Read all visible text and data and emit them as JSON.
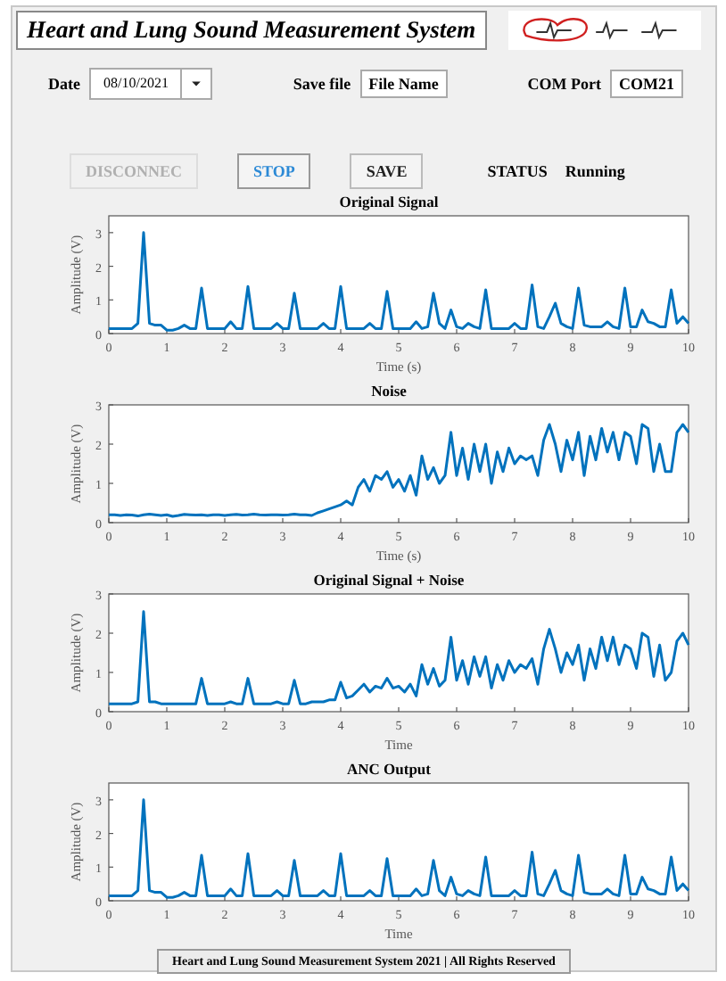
{
  "header": {
    "title": "Heart and Lung Sound Measurement System"
  },
  "fields": [
    {
      "label": "Date",
      "value": "08/10/2021",
      "kind": "dropdown"
    },
    {
      "label": "Save file",
      "value": "File Name",
      "kind": "text"
    },
    {
      "label": "COM Port",
      "value": "COM21",
      "kind": "text"
    }
  ],
  "buttons": [
    {
      "label": "DISCONNEC",
      "disabled": true,
      "active": false
    },
    {
      "label": "STOP",
      "disabled": false,
      "active": true
    },
    {
      "label": "SAVE",
      "disabled": false,
      "active": false
    }
  ],
  "status": {
    "label": "STATUS",
    "value": "Running"
  },
  "plots": [
    {
      "chart_data": {
        "type": "line",
        "title": "Original Signal",
        "xlabel": "Time (s)",
        "ylabel": "Amplitude (V)",
        "xlim": [
          0,
          10
        ],
        "ylim": [
          0,
          3.5
        ],
        "xticks": [
          0,
          1,
          2,
          3,
          4,
          5,
          6,
          7,
          8,
          9,
          10
        ],
        "yticks": [
          0,
          1,
          2,
          3
        ],
        "x": [
          0,
          0.1,
          0.2,
          0.3,
          0.4,
          0.5,
          0.6,
          0.7,
          0.8,
          0.9,
          1,
          1.1,
          1.2,
          1.3,
          1.4,
          1.5,
          1.6,
          1.7,
          1.8,
          1.9,
          2,
          2.1,
          2.2,
          2.3,
          2.4,
          2.5,
          2.6,
          2.7,
          2.8,
          2.9,
          3,
          3.1,
          3.2,
          3.3,
          3.4,
          3.5,
          3.6,
          3.7,
          3.8,
          3.9,
          4,
          4.1,
          4.2,
          4.3,
          4.4,
          4.5,
          4.6,
          4.7,
          4.8,
          4.9,
          5,
          5.1,
          5.2,
          5.3,
          5.4,
          5.5,
          5.6,
          5.7,
          5.8,
          5.9,
          6,
          6.1,
          6.2,
          6.3,
          6.4,
          6.5,
          6.6,
          6.7,
          6.8,
          6.9,
          7,
          7.1,
          7.2,
          7.3,
          7.4,
          7.5,
          7.6,
          7.7,
          7.8,
          7.9,
          8,
          8.1,
          8.2,
          8.3,
          8.4,
          8.5,
          8.6,
          8.7,
          8.8,
          8.9,
          9,
          9.1,
          9.2,
          9.3,
          9.4,
          9.5,
          9.6,
          9.7,
          9.8,
          9.9,
          10
        ],
        "series": [
          {
            "color": "#0072bd",
            "values": [
              0.15,
              0.15,
              0.15,
              0.15,
              0.15,
              0.3,
              3.0,
              0.3,
              0.25,
              0.25,
              0.1,
              0.1,
              0.15,
              0.25,
              0.15,
              0.15,
              1.35,
              0.15,
              0.15,
              0.15,
              0.15,
              0.35,
              0.15,
              0.15,
              1.4,
              0.15,
              0.15,
              0.15,
              0.15,
              0.3,
              0.15,
              0.15,
              1.2,
              0.15,
              0.15,
              0.15,
              0.15,
              0.3,
              0.15,
              0.15,
              1.4,
              0.15,
              0.15,
              0.15,
              0.15,
              0.3,
              0.15,
              0.15,
              1.25,
              0.15,
              0.15,
              0.15,
              0.15,
              0.35,
              0.15,
              0.2,
              1.2,
              0.3,
              0.15,
              0.7,
              0.2,
              0.15,
              0.3,
              0.2,
              0.15,
              1.3,
              0.15,
              0.15,
              0.15,
              0.15,
              0.3,
              0.15,
              0.15,
              1.45,
              0.2,
              0.15,
              0.5,
              0.9,
              0.3,
              0.2,
              0.15,
              1.35,
              0.25,
              0.2,
              0.2,
              0.2,
              0.35,
              0.2,
              0.15,
              1.35,
              0.2,
              0.2,
              0.7,
              0.35,
              0.3,
              0.2,
              0.2,
              1.3,
              0.3,
              0.5,
              0.3
            ]
          }
        ]
      }
    },
    {
      "chart_data": {
        "type": "line",
        "title": "Noise",
        "xlabel": "Time (s)",
        "ylabel": "Amplitude (V)",
        "xlim": [
          0,
          10
        ],
        "ylim": [
          0,
          3
        ],
        "xticks": [
          0,
          1,
          2,
          3,
          4,
          5,
          6,
          7,
          8,
          9,
          10
        ],
        "yticks": [
          0,
          1,
          2,
          3
        ],
        "x": [
          0,
          0.1,
          0.2,
          0.3,
          0.4,
          0.5,
          0.6,
          0.7,
          0.8,
          0.9,
          1,
          1.1,
          1.2,
          1.3,
          1.4,
          1.5,
          1.6,
          1.7,
          1.8,
          1.9,
          2,
          2.1,
          2.2,
          2.3,
          2.4,
          2.5,
          2.6,
          2.7,
          2.8,
          2.9,
          3,
          3.1,
          3.2,
          3.3,
          3.4,
          3.5,
          3.6,
          3.7,
          3.8,
          3.9,
          4,
          4.1,
          4.2,
          4.3,
          4.4,
          4.5,
          4.6,
          4.7,
          4.8,
          4.9,
          5,
          5.1,
          5.2,
          5.3,
          5.4,
          5.5,
          5.6,
          5.7,
          5.8,
          5.9,
          6,
          6.1,
          6.2,
          6.3,
          6.4,
          6.5,
          6.6,
          6.7,
          6.8,
          6.9,
          7,
          7.1,
          7.2,
          7.3,
          7.4,
          7.5,
          7.6,
          7.7,
          7.8,
          7.9,
          8,
          8.1,
          8.2,
          8.3,
          8.4,
          8.5,
          8.6,
          8.7,
          8.8,
          8.9,
          9,
          9.1,
          9.2,
          9.3,
          9.4,
          9.5,
          9.6,
          9.7,
          9.8,
          9.9,
          10
        ],
        "series": [
          {
            "color": "#0072bd",
            "values": [
              0.2,
              0.2,
              0.18,
              0.2,
              0.19,
              0.17,
              0.2,
              0.22,
              0.2,
              0.18,
              0.2,
              0.16,
              0.18,
              0.21,
              0.2,
              0.19,
              0.2,
              0.18,
              0.2,
              0.2,
              0.18,
              0.2,
              0.21,
              0.19,
              0.2,
              0.22,
              0.2,
              0.19,
              0.2,
              0.2,
              0.19,
              0.2,
              0.22,
              0.2,
              0.2,
              0.18,
              0.25,
              0.3,
              0.35,
              0.4,
              0.45,
              0.55,
              0.45,
              0.9,
              1.1,
              0.8,
              1.2,
              1.1,
              1.3,
              0.9,
              1.1,
              0.8,
              1.2,
              0.7,
              1.7,
              1.1,
              1.4,
              1.0,
              1.2,
              2.3,
              1.2,
              1.9,
              1.1,
              2.0,
              1.3,
              2.0,
              1.0,
              1.8,
              1.3,
              1.9,
              1.5,
              1.7,
              1.6,
              1.7,
              1.2,
              2.1,
              2.5,
              2.0,
              1.3,
              2.1,
              1.6,
              2.3,
              1.2,
              2.2,
              1.6,
              2.4,
              1.8,
              2.3,
              1.6,
              2.3,
              2.2,
              1.5,
              2.5,
              2.4,
              1.3,
              2.0,
              1.3,
              1.3,
              2.3,
              2.5,
              2.3
            ]
          }
        ]
      }
    },
    {
      "chart_data": {
        "type": "line",
        "title": "Original Signal + Noise",
        "xlabel": "Time",
        "ylabel": "Amplitude (V)",
        "xlim": [
          0,
          10
        ],
        "ylim": [
          0,
          3
        ],
        "xticks": [
          0,
          1,
          2,
          3,
          4,
          5,
          6,
          7,
          8,
          9,
          10
        ],
        "yticks": [
          0,
          1,
          2,
          3
        ],
        "x": [
          0,
          0.1,
          0.2,
          0.3,
          0.4,
          0.5,
          0.6,
          0.7,
          0.8,
          0.9,
          1,
          1.1,
          1.2,
          1.3,
          1.4,
          1.5,
          1.6,
          1.7,
          1.8,
          1.9,
          2,
          2.1,
          2.2,
          2.3,
          2.4,
          2.5,
          2.6,
          2.7,
          2.8,
          2.9,
          3,
          3.1,
          3.2,
          3.3,
          3.4,
          3.5,
          3.6,
          3.7,
          3.8,
          3.9,
          4,
          4.1,
          4.2,
          4.3,
          4.4,
          4.5,
          4.6,
          4.7,
          4.8,
          4.9,
          5,
          5.1,
          5.2,
          5.3,
          5.4,
          5.5,
          5.6,
          5.7,
          5.8,
          5.9,
          6,
          6.1,
          6.2,
          6.3,
          6.4,
          6.5,
          6.6,
          6.7,
          6.8,
          6.9,
          7,
          7.1,
          7.2,
          7.3,
          7.4,
          7.5,
          7.6,
          7.7,
          7.8,
          7.9,
          8,
          8.1,
          8.2,
          8.3,
          8.4,
          8.5,
          8.6,
          8.7,
          8.8,
          8.9,
          9,
          9.1,
          9.2,
          9.3,
          9.4,
          9.5,
          9.6,
          9.7,
          9.8,
          9.9,
          10
        ],
        "series": [
          {
            "color": "#0072bd",
            "values": [
              0.2,
              0.2,
              0.2,
              0.2,
              0.2,
              0.25,
              2.55,
              0.25,
              0.25,
              0.2,
              0.2,
              0.2,
              0.2,
              0.2,
              0.2,
              0.2,
              0.85,
              0.2,
              0.2,
              0.2,
              0.2,
              0.25,
              0.2,
              0.2,
              0.85,
              0.2,
              0.2,
              0.2,
              0.2,
              0.25,
              0.2,
              0.2,
              0.8,
              0.2,
              0.2,
              0.25,
              0.25,
              0.25,
              0.3,
              0.3,
              0.75,
              0.35,
              0.4,
              0.55,
              0.7,
              0.5,
              0.65,
              0.6,
              0.85,
              0.6,
              0.65,
              0.5,
              0.7,
              0.4,
              1.2,
              0.7,
              1.1,
              0.65,
              0.8,
              1.9,
              0.8,
              1.3,
              0.7,
              1.4,
              0.9,
              1.4,
              0.6,
              1.2,
              0.8,
              1.3,
              1.0,
              1.2,
              1.1,
              1.35,
              0.7,
              1.6,
              2.1,
              1.6,
              1.0,
              1.5,
              1.2,
              1.7,
              0.8,
              1.6,
              1.1,
              1.9,
              1.3,
              1.9,
              1.2,
              1.7,
              1.6,
              1.1,
              2.0,
              1.9,
              0.9,
              1.7,
              0.8,
              1.0,
              1.8,
              2.0,
              1.7
            ]
          }
        ]
      }
    },
    {
      "chart_data": {
        "type": "line",
        "title": "ANC Output",
        "xlabel": "Time",
        "ylabel": "Amplitude (V)",
        "xlim": [
          0,
          10
        ],
        "ylim": [
          0,
          3.5
        ],
        "xticks": [
          0,
          1,
          2,
          3,
          4,
          5,
          6,
          7,
          8,
          9,
          10
        ],
        "yticks": [
          0,
          1,
          2,
          3
        ],
        "x": [
          0,
          0.1,
          0.2,
          0.3,
          0.4,
          0.5,
          0.6,
          0.7,
          0.8,
          0.9,
          1,
          1.1,
          1.2,
          1.3,
          1.4,
          1.5,
          1.6,
          1.7,
          1.8,
          1.9,
          2,
          2.1,
          2.2,
          2.3,
          2.4,
          2.5,
          2.6,
          2.7,
          2.8,
          2.9,
          3,
          3.1,
          3.2,
          3.3,
          3.4,
          3.5,
          3.6,
          3.7,
          3.8,
          3.9,
          4,
          4.1,
          4.2,
          4.3,
          4.4,
          4.5,
          4.6,
          4.7,
          4.8,
          4.9,
          5,
          5.1,
          5.2,
          5.3,
          5.4,
          5.5,
          5.6,
          5.7,
          5.8,
          5.9,
          6,
          6.1,
          6.2,
          6.3,
          6.4,
          6.5,
          6.6,
          6.7,
          6.8,
          6.9,
          7,
          7.1,
          7.2,
          7.3,
          7.4,
          7.5,
          7.6,
          7.7,
          7.8,
          7.9,
          8,
          8.1,
          8.2,
          8.3,
          8.4,
          8.5,
          8.6,
          8.7,
          8.8,
          8.9,
          9,
          9.1,
          9.2,
          9.3,
          9.4,
          9.5,
          9.6,
          9.7,
          9.8,
          9.9,
          10
        ],
        "series": [
          {
            "color": "#0072bd",
            "values": [
              0.15,
              0.15,
              0.15,
              0.15,
              0.15,
              0.3,
              3.0,
              0.3,
              0.25,
              0.25,
              0.1,
              0.1,
              0.15,
              0.25,
              0.15,
              0.15,
              1.35,
              0.15,
              0.15,
              0.15,
              0.15,
              0.35,
              0.15,
              0.15,
              1.4,
              0.15,
              0.15,
              0.15,
              0.15,
              0.3,
              0.15,
              0.15,
              1.2,
              0.15,
              0.15,
              0.15,
              0.15,
              0.3,
              0.15,
              0.15,
              1.4,
              0.15,
              0.15,
              0.15,
              0.15,
              0.3,
              0.15,
              0.15,
              1.25,
              0.15,
              0.15,
              0.15,
              0.15,
              0.35,
              0.15,
              0.2,
              1.2,
              0.3,
              0.15,
              0.7,
              0.2,
              0.15,
              0.3,
              0.2,
              0.15,
              1.3,
              0.15,
              0.15,
              0.15,
              0.15,
              0.3,
              0.15,
              0.15,
              1.45,
              0.2,
              0.15,
              0.5,
              0.9,
              0.3,
              0.2,
              0.15,
              1.35,
              0.25,
              0.2,
              0.2,
              0.2,
              0.35,
              0.2,
              0.15,
              1.35,
              0.2,
              0.2,
              0.7,
              0.35,
              0.3,
              0.2,
              0.2,
              1.3,
              0.3,
              0.5,
              0.3
            ]
          }
        ]
      }
    }
  ],
  "footer": {
    "text": "Heart and Lung Sound Measurement System 2021 | All Rights Reserved"
  }
}
